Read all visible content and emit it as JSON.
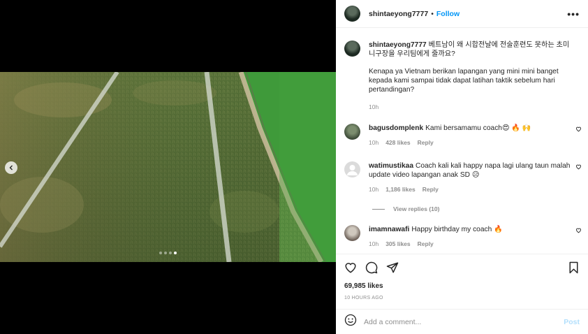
{
  "post": {
    "username": "shintaeyong7777",
    "separator": "•",
    "follow_label": "Follow",
    "more_label": "•••"
  },
  "caption": {
    "username": "shintaeyong7777",
    "text_korean": "베트남이 왜 시합전날에 전술훈련도 못하는 초미니구장을 우리팀에게 줄까요?",
    "text_indonesian": "Kenapa ya Vietnam berikan lapangan yang mini mini banget kepada kami sampai tidak dapat latihan taktik sebelum hari pertandingan?",
    "time": "10h"
  },
  "comments": [
    {
      "username": "bagusdomplenk",
      "text": "Kami bersamamu coach😍 🔥 🙌",
      "time": "10h",
      "likes": "428 likes",
      "reply": "Reply"
    },
    {
      "username": "watimustikaa",
      "text": "Coach kali kali happy napa lagi ulang taun malah update video lapangan anak SD 😥",
      "time": "10h",
      "likes": "1,186 likes",
      "reply": "Reply"
    },
    {
      "username": "imamnawafi",
      "text": "Happy birthday my coach 🔥",
      "time": "10h",
      "likes": "305 likes",
      "reply": "Reply"
    }
  ],
  "view_replies": "View replies (10)",
  "stats": {
    "likes": "69,985 likes",
    "time_ago": "10 HOURS AGO"
  },
  "add_comment": {
    "placeholder": "Add a comment...",
    "post_label": "Post"
  },
  "carousel": {
    "total_slides": 4,
    "active_slide": 4
  },
  "colors": {
    "accent": "#0095f6",
    "post_disabled": "#b2dffc",
    "muted": "#8e8e8e"
  }
}
